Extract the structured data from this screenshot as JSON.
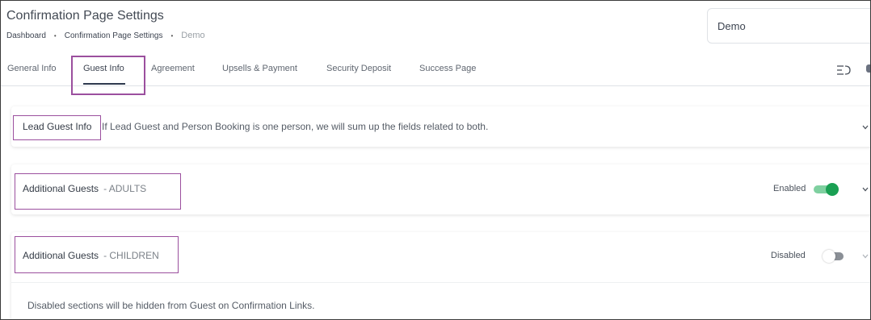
{
  "header": {
    "title": "Confirmation Page Settings",
    "breadcrumb": [
      "Dashboard",
      "Confirmation Page Settings",
      "Demo"
    ],
    "breadcrumb_separator": "•"
  },
  "property_select": {
    "value": "Demo"
  },
  "tabs": [
    {
      "label": "General Info",
      "active": false
    },
    {
      "label": "Guest Info",
      "active": true
    },
    {
      "label": "Agreement",
      "active": false
    },
    {
      "label": "Upsells & Payment",
      "active": false
    },
    {
      "label": "Security Deposit",
      "active": false
    },
    {
      "label": "Success Page",
      "active": false
    }
  ],
  "sections": {
    "lead": {
      "title": "Lead Guest Info",
      "description": "If Lead Guest and Person Booking is one person, we will sum up the fields related to both."
    },
    "adults": {
      "title": "Additional Guests",
      "subtitle": "- ADULTS",
      "status_label": "Enabled",
      "enabled": true
    },
    "children": {
      "title": "Additional Guests",
      "subtitle": "- CHILDREN",
      "status_label": "Disabled",
      "enabled": false
    }
  },
  "footer_note": "Disabled sections will be hidden from Guest on Confirmation Links.",
  "colors": {
    "accent_highlight": "#9b4f9e",
    "toggle_on": "#1aa053",
    "toggle_off": "#8a8f96"
  }
}
